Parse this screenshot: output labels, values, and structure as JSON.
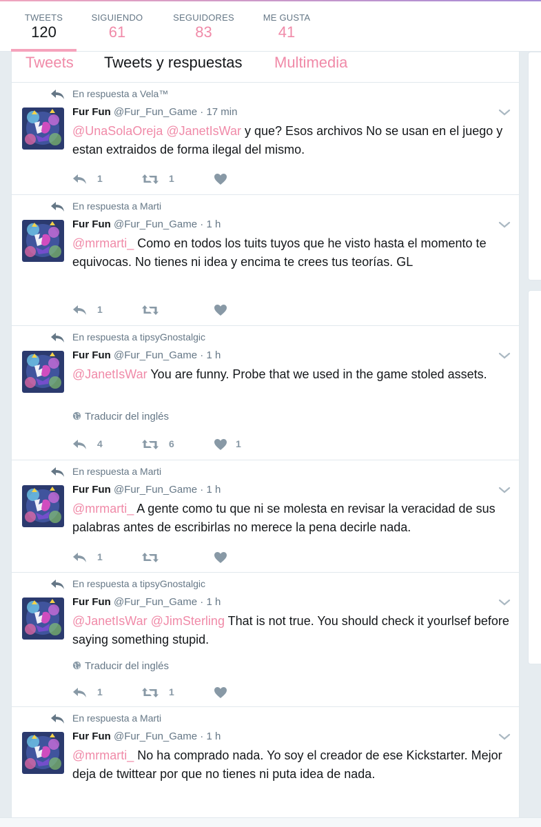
{
  "colors": {
    "accent": "#f08aa8",
    "text": "#14171a",
    "muted": "#657786",
    "action": "#8899a6",
    "background": "#e6ecf0"
  },
  "nav": {
    "stats": [
      {
        "label": "TWEETS",
        "value": "120"
      },
      {
        "label": "SIGUIENDO",
        "value": "61"
      },
      {
        "label": "SEGUIDORES",
        "value": "83"
      },
      {
        "label": "ME GUSTA",
        "value": "41"
      }
    ]
  },
  "tabs": [
    "Tweets",
    "Tweets y respuestas",
    "Multimedia"
  ],
  "tweets": [
    {
      "reply_to": "En respuesta a Vela™",
      "name": "Fur Fun",
      "handle": "@Fur_Fun_Game",
      "sep": "·",
      "time": "17 min",
      "mention1": "@UnaSolaOreja",
      "mention2": "@JanetIsWar",
      "text": "y que? Esos archivos No se usan en el juego y estan extraidos de forma ilegal del mismo.",
      "reply_count": "1",
      "retweet_count": "1",
      "like_count": ""
    },
    {
      "reply_to": "En respuesta a Marti",
      "name": "Fur Fun",
      "handle": "@Fur_Fun_Game",
      "sep": "·",
      "time": "1 h",
      "mention1": "@mrmarti_",
      "text": "Como en todos los tuits tuyos que he visto hasta el momento te equivocas. No tienes ni idea y encima te crees tus teorías. GL",
      "reply_count": "1",
      "retweet_count": "",
      "like_count": ""
    },
    {
      "reply_to": "En respuesta a tipsyGnostalgic",
      "name": "Fur Fun",
      "handle": "@Fur_Fun_Game",
      "sep": "·",
      "time": "1 h",
      "mention1": "@JanetIsWar",
      "text": "You are funny. Probe that we used in the game stoled assets.",
      "translate": "Traducir del inglés",
      "reply_count": "4",
      "retweet_count": "6",
      "like_count": "1"
    },
    {
      "reply_to": "En respuesta a Marti",
      "name": "Fur Fun",
      "handle": "@Fur_Fun_Game",
      "sep": "·",
      "time": "1 h",
      "mention1": "@mrmarti_",
      "text": "A gente como tu que ni se molesta en revisar la veracidad de sus palabras antes de escribirlas no merece la pena decirle nada.",
      "reply_count": "1",
      "retweet_count": "",
      "like_count": ""
    },
    {
      "reply_to": "En respuesta a tipsyGnostalgic",
      "name": "Fur Fun",
      "handle": "@Fur_Fun_Game",
      "sep": "·",
      "time": "1 h",
      "mention1": "@JanetIsWar",
      "mention2": "@JimSterling",
      "text": "That is not true. You should check it yourlsef before saying something stupid.",
      "translate": "Traducir del inglés",
      "reply_count": "1",
      "retweet_count": "1",
      "like_count": ""
    },
    {
      "reply_to": "En respuesta a Marti",
      "name": "Fur Fun",
      "handle": "@Fur_Fun_Game",
      "sep": "·",
      "time": "1 h",
      "mention1": "@mrmarti_",
      "text": "No ha comprado nada. Yo soy el creador de ese Kickstarter. Mejor deja de twittear por que no tienes ni puta idea de nada."
    }
  ]
}
